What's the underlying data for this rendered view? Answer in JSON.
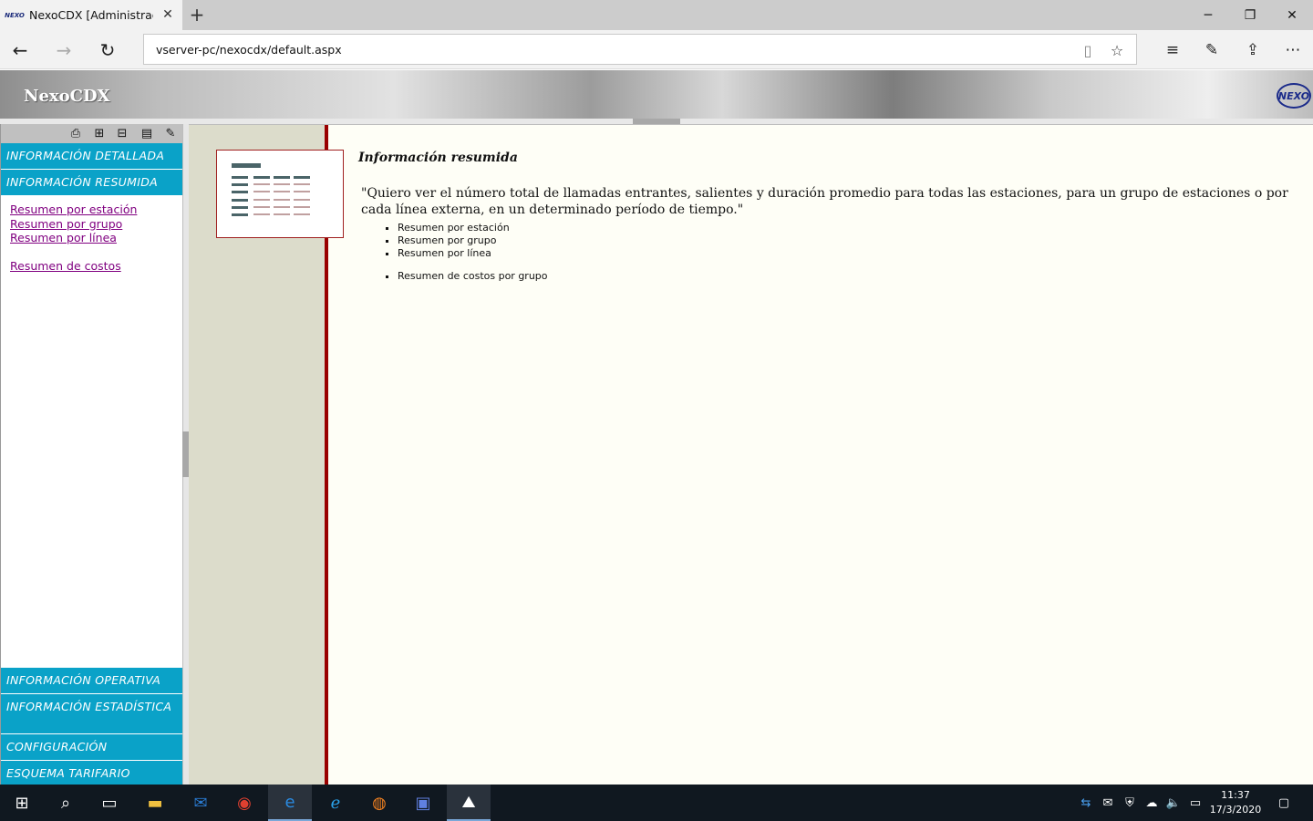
{
  "browser": {
    "tab_title": "NexoCDX [Administrador]",
    "tab_favicon": "NEXO",
    "url": "vserver-pc/nexocdx/default.aspx"
  },
  "header": {
    "title": "NexoCDX",
    "logo": "NEXO"
  },
  "sidebar": {
    "sections_top": [
      "INFORMACIÓN DETALLADA",
      "INFORMACIÓN RESUMIDA"
    ],
    "links": [
      "Resumen por estación",
      "Resumen por grupo",
      "Resumen por línea",
      "Resumen de costos"
    ],
    "sections_bottom": [
      "INFORMACIÓN OPERATIVA",
      "INFORMACIÓN ESTADÍSTICA",
      "CONFIGURACIÓN",
      "ESQUEMA TARIFARIO"
    ]
  },
  "content": {
    "title": "Información resumida",
    "quote": "\"Quiero ver el número total de llamadas entrantes, salientes y duración promedio para todas las estaciones, para un grupo de estaciones o por cada línea externa, en un determinado período de tiempo.\"",
    "list": [
      "Resumen por estación",
      "Resumen por grupo",
      "Resumen por línea"
    ],
    "list2": [
      "Resumen de costos por grupo"
    ]
  },
  "taskbar": {
    "time": "11:37",
    "date": "17/3/2020"
  }
}
